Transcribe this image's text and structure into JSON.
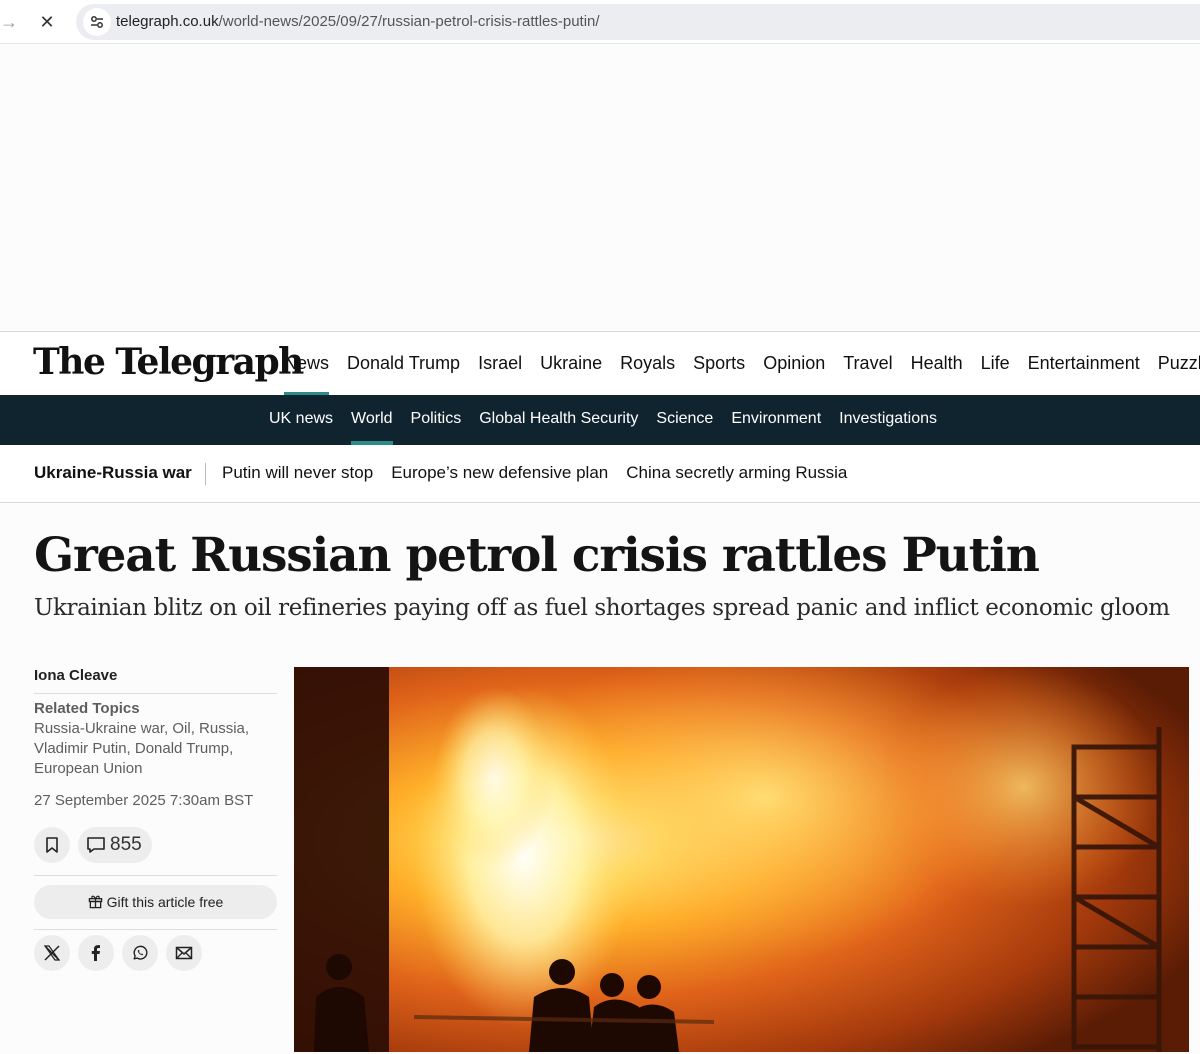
{
  "browser": {
    "url_domain": "telegraph.co.uk",
    "url_path": "/world-news/2025/09/27/russian-petrol-crisis-rattles-putin/"
  },
  "masthead": {
    "logo": "The Telegraph",
    "nav": [
      "News",
      "Donald Trump",
      "Israel",
      "Ukraine",
      "Royals",
      "Sports",
      "Opinion",
      "Travel",
      "Health",
      "Life",
      "Entertainment",
      "Puzzles"
    ],
    "active": "News"
  },
  "secondary_nav": {
    "items": [
      "UK news",
      "World",
      "Politics",
      "Global Health Security",
      "Science",
      "Environment",
      "Investigations"
    ],
    "active": "World"
  },
  "topic_strip": {
    "main": "Ukraine-Russia war",
    "links": [
      "Putin will never stop",
      "Europe’s new defensive plan",
      "China secretly arming Russia"
    ]
  },
  "article": {
    "headline": "Great Russian petrol crisis rattles Putin",
    "standfirst": "Ukrainian blitz on oil refineries paying off as fuel shortages spread panic and inflict economic gloom",
    "author": "Iona Cleave",
    "related_label": "Related Topics",
    "related_line1": "Russia-Ukraine war, Oil, Russia,",
    "related_line2": "Vladimir Putin, Donald Trump,",
    "related_line3": "European Union",
    "date": "27 September 2025 7:30am BST",
    "comment_count": "855",
    "gift_label": "Gift this article free"
  },
  "icons": {
    "nav": "arrow-right-icon",
    "close": "close-icon",
    "site_info": "tune-icon",
    "bookmark": "bookmark-icon",
    "comment": "comment-icon",
    "gift": "gift-icon",
    "share": [
      "x-icon",
      "facebook-icon",
      "whatsapp-icon",
      "email-icon"
    ]
  },
  "colors": {
    "accent": "#2c8c8a",
    "nav_dark": "#10242f"
  }
}
